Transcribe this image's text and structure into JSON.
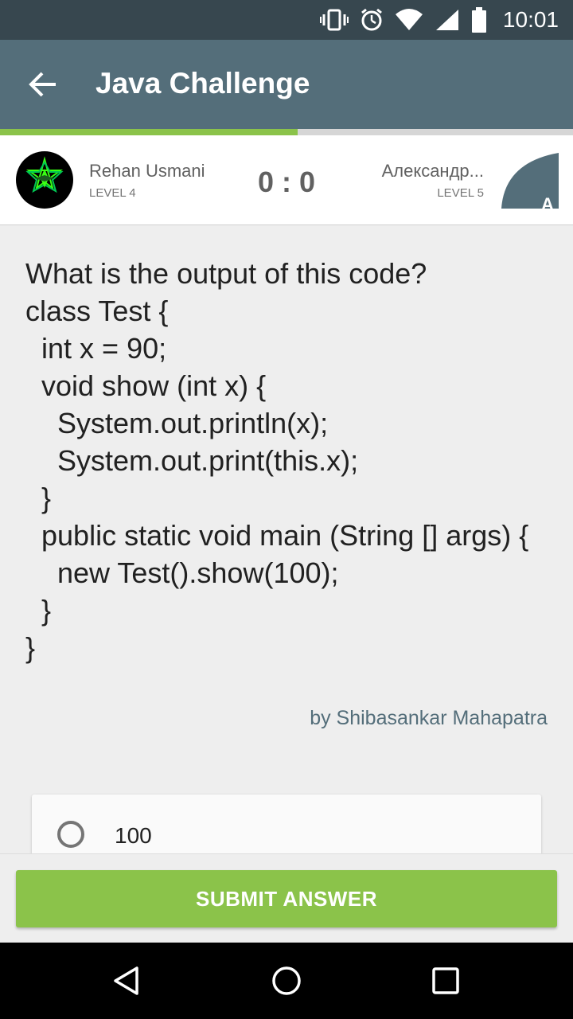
{
  "status_bar": {
    "time": "10:01",
    "icons": [
      "vibrate-icon",
      "alarm-icon",
      "wifi-icon",
      "signal-icon",
      "battery-icon"
    ]
  },
  "app_bar": {
    "title": "Java Challenge",
    "back_icon": "arrow-back-icon"
  },
  "progress": {
    "fraction": 0.52,
    "fill_color": "#8bc34a"
  },
  "players": {
    "player1": {
      "name": "Rehan Usmani",
      "level": "LEVEL 4"
    },
    "score": "0 : 0",
    "player2": {
      "name": "Александр...",
      "level": "LEVEL 5",
      "avatar_letter": "A"
    }
  },
  "question": {
    "text": "What is the output of this code?\nclass Test {\n  int x = 90;\n  void show (int x) {\n    System.out.println(x);\n    System.out.print(this.x);\n  }\n  public static void main (String [] args) {\n    new Test().show(100);\n  }\n}",
    "author": "by Shibasankar Mahapatra"
  },
  "answers": [
    {
      "label": "100"
    }
  ],
  "submit": {
    "label": "SUBMIT ANSWER"
  },
  "colors": {
    "status_bar": "#37474f",
    "app_bar": "#546e7a",
    "accent_green": "#8bc34a",
    "author_text": "#546e7a"
  }
}
